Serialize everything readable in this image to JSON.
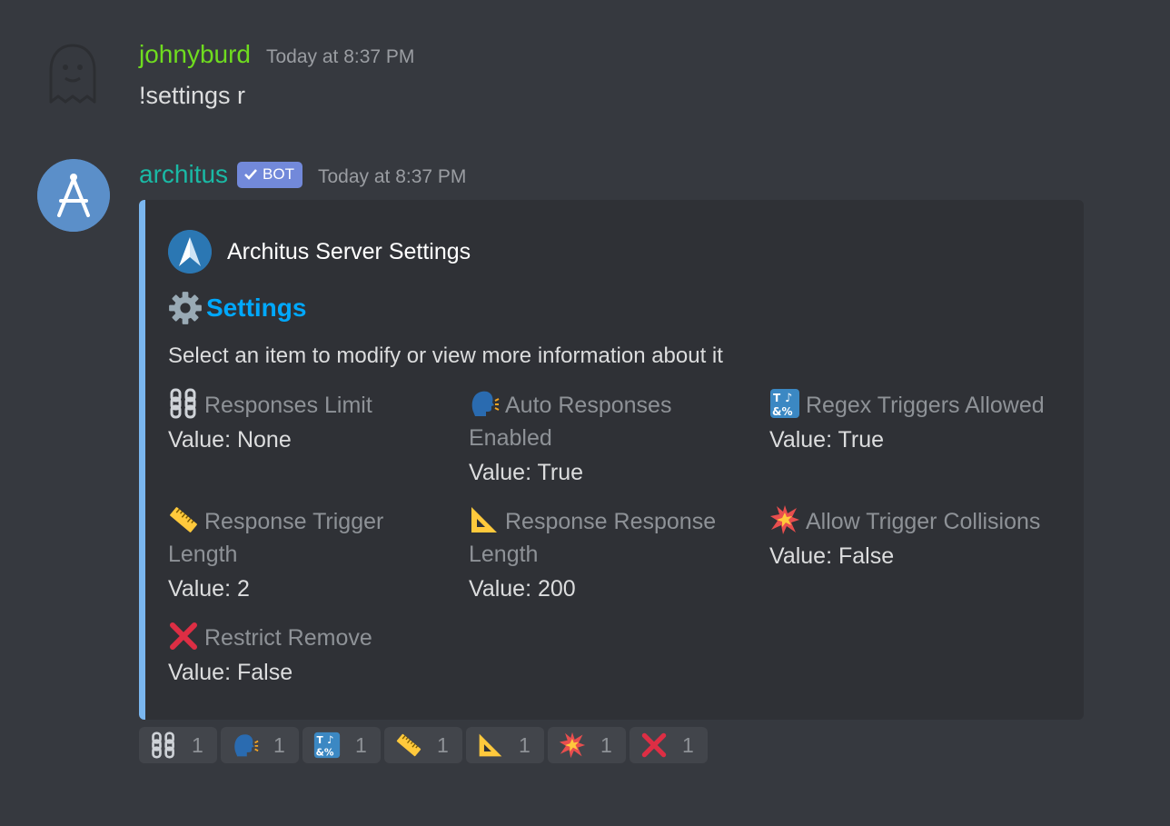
{
  "messages": {
    "user": {
      "username": "johnyburd",
      "username_color": "#6fdc1f",
      "timestamp": "Today at 8:37 PM",
      "text": "!settings r"
    },
    "bot": {
      "username": "architus",
      "username_color": "#1ab9a5",
      "bot_tag": "BOT",
      "timestamp": "Today at 8:37 PM"
    }
  },
  "embed": {
    "author": "Architus Server Settings",
    "title_icon": "gear-icon",
    "title": "Settings",
    "title_color": "#00a8fc",
    "accent_color": "#7ab6ef",
    "description": "Select an item to modify or view more information about it",
    "fields": [
      {
        "icon": "chains-icon",
        "name": "Responses Limit",
        "value": "Value: None"
      },
      {
        "icon": "speaking-head-icon",
        "name": "Auto Responses Enabled",
        "value": "Value: True"
      },
      {
        "icon": "symbols-icon",
        "name": "Regex Triggers Allowed",
        "value": "Value: True"
      },
      {
        "icon": "straight-ruler-icon",
        "name": "Response Trigger Length",
        "value": "Value: 2"
      },
      {
        "icon": "triangular-ruler-icon",
        "name": "Response Response Length",
        "value": "Value: 200"
      },
      {
        "icon": "collision-icon",
        "name": "Allow Trigger Collisions",
        "value": "Value: False"
      },
      {
        "icon": "cross-mark-icon",
        "name": "Restrict Remove",
        "value": "Value: False"
      }
    ]
  },
  "reactions": [
    {
      "icon": "chains-icon",
      "count": "1"
    },
    {
      "icon": "speaking-head-icon",
      "count": "1"
    },
    {
      "icon": "symbols-icon",
      "count": "1"
    },
    {
      "icon": "straight-ruler-icon",
      "count": "1"
    },
    {
      "icon": "triangular-ruler-icon",
      "count": "1"
    },
    {
      "icon": "collision-icon",
      "count": "1"
    },
    {
      "icon": "cross-mark-icon",
      "count": "1"
    }
  ]
}
